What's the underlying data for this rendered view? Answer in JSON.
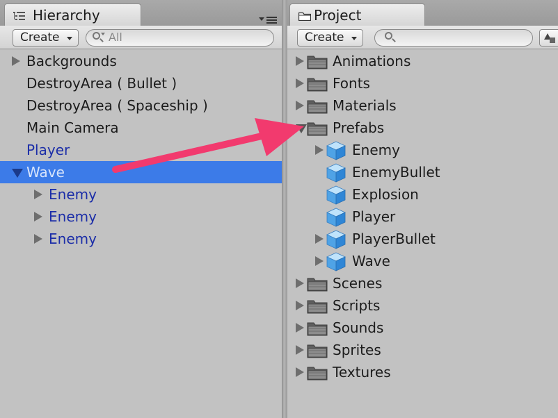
{
  "hierarchy": {
    "tab_label": "Hierarchy",
    "tab_icon": "list-icon",
    "menu_icon": "panel-menu-icon",
    "create_label": "Create",
    "search_placeholder": "All",
    "items": [
      {
        "label": "Backgrounds",
        "expand": "collapsed",
        "indent": 0,
        "style": "normal"
      },
      {
        "label": "DestroyArea ( Bullet )",
        "expand": "none",
        "indent": 0,
        "style": "normal"
      },
      {
        "label": "DestroyArea ( Spaceship )",
        "expand": "none",
        "indent": 0,
        "style": "normal"
      },
      {
        "label": "Main Camera",
        "expand": "none",
        "indent": 0,
        "style": "normal"
      },
      {
        "label": "Player",
        "expand": "none",
        "indent": 0,
        "style": "prefab"
      },
      {
        "label": "Wave",
        "expand": "expanded",
        "indent": 0,
        "style": "selected"
      },
      {
        "label": "Enemy",
        "expand": "collapsed",
        "indent": 1,
        "style": "prefab"
      },
      {
        "label": "Enemy",
        "expand": "collapsed",
        "indent": 1,
        "style": "prefab"
      },
      {
        "label": "Enemy",
        "expand": "collapsed",
        "indent": 1,
        "style": "prefab"
      }
    ]
  },
  "project": {
    "tab_label": "Project",
    "tab_icon": "folder-icon",
    "create_label": "Create",
    "search_placeholder": "",
    "items": [
      {
        "label": "Animations",
        "expand": "collapsed",
        "indent": 0,
        "icon": "folder"
      },
      {
        "label": "Fonts",
        "expand": "collapsed",
        "indent": 0,
        "icon": "folder"
      },
      {
        "label": "Materials",
        "expand": "collapsed",
        "indent": 0,
        "icon": "folder"
      },
      {
        "label": "Prefabs",
        "expand": "expanded",
        "indent": 0,
        "icon": "folder"
      },
      {
        "label": "Enemy",
        "expand": "collapsed",
        "indent": 1,
        "icon": "prefab"
      },
      {
        "label": "EnemyBullet",
        "expand": "none",
        "indent": 1,
        "icon": "prefab"
      },
      {
        "label": "Explosion",
        "expand": "none",
        "indent": 1,
        "icon": "prefab"
      },
      {
        "label": "Player",
        "expand": "none",
        "indent": 1,
        "icon": "prefab"
      },
      {
        "label": "PlayerBullet",
        "expand": "collapsed",
        "indent": 1,
        "icon": "prefab"
      },
      {
        "label": "Wave",
        "expand": "collapsed",
        "indent": 1,
        "icon": "prefab"
      },
      {
        "label": "Scenes",
        "expand": "collapsed",
        "indent": 0,
        "icon": "folder"
      },
      {
        "label": "Scripts",
        "expand": "collapsed",
        "indent": 0,
        "icon": "folder"
      },
      {
        "label": "Sounds",
        "expand": "collapsed",
        "indent": 0,
        "icon": "folder"
      },
      {
        "label": "Sprites",
        "expand": "collapsed",
        "indent": 0,
        "icon": "folder"
      },
      {
        "label": "Textures",
        "expand": "collapsed",
        "indent": 0,
        "icon": "folder"
      }
    ]
  },
  "colors": {
    "selection": "#3c7be8",
    "prefab_text": "#1c2ea8",
    "annotation_arrow": "#f23a6e"
  },
  "annotation": {
    "type": "arrow",
    "from": "hierarchy item Wave",
    "to": "project folder Prefabs"
  }
}
